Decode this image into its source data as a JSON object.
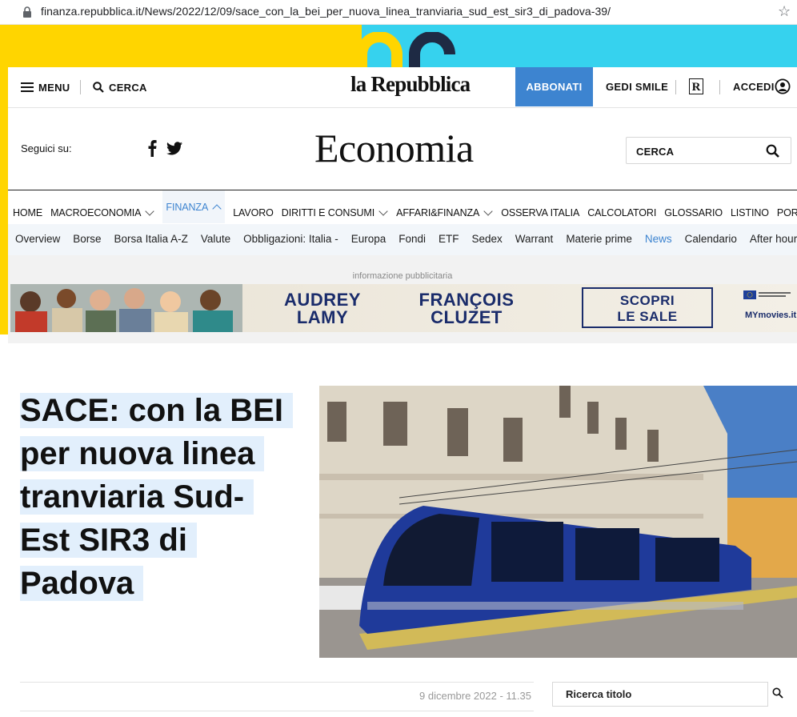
{
  "browser": {
    "url": "finanza.repubblica.it/News/2022/12/09/sace_con_la_bei_per_nuova_linea_tranviaria_sud_est_sir3_di_padova-39/"
  },
  "topbar": {
    "menu_label": "MENU",
    "search_label": "CERCA",
    "masthead": "la Repubblica",
    "subscribe_label": "ABBONATI",
    "gedi_label": "GEDI SMILE",
    "r_label": "R",
    "login_label": "ACCEDI"
  },
  "section": {
    "follow_label": "Seguici su:",
    "title": "Economia",
    "search_placeholder": "CERCA"
  },
  "nav_main": [
    {
      "label": "HOME",
      "dropdown": false
    },
    {
      "label": "MACROECONOMIA",
      "dropdown": true
    },
    {
      "label": "FINANZA",
      "dropdown": true,
      "active": true
    },
    {
      "label": "LAVORO",
      "dropdown": false
    },
    {
      "label": "DIRITTI E CONSUMI",
      "dropdown": true
    },
    {
      "label": "AFFARI&FINANZA",
      "dropdown": true
    },
    {
      "label": "OSSERVA ITALIA",
      "dropdown": false
    },
    {
      "label": "CALCOLATORI",
      "dropdown": false
    },
    {
      "label": "GLOSSARIO",
      "dropdown": false
    },
    {
      "label": "LISTINO",
      "dropdown": false
    },
    {
      "label": "PORTAFOGLIO",
      "dropdown": false
    }
  ],
  "nav_sub": [
    {
      "label": "Overview"
    },
    {
      "label": "Borse"
    },
    {
      "label": "Borsa Italia A-Z"
    },
    {
      "label": "Valute"
    },
    {
      "label": "Obbligazioni: Italia -"
    },
    {
      "label": "Europa"
    },
    {
      "label": "Fondi"
    },
    {
      "label": "ETF"
    },
    {
      "label": "Sedex"
    },
    {
      "label": "Warrant"
    },
    {
      "label": "Materie prime"
    },
    {
      "label": "News",
      "active": true
    },
    {
      "label": "Calendario"
    },
    {
      "label": "After hours"
    }
  ],
  "ad": {
    "label": "informazione pubblicitaria",
    "name1_line1": "AUDREY",
    "name1_line2": "LAMY",
    "name2_line1": "FRANÇOIS",
    "name2_line2": "CLUZET",
    "cta_line1": "SCOPRI",
    "cta_line2": "LE SALE",
    "sponsor": "MYmovies.it"
  },
  "article": {
    "headline_lines": [
      "SACE: con la BEI",
      "per nuova linea",
      "tranviaria Sud-",
      "Est SIR3 di",
      "Padova"
    ],
    "date": "9 dicembre 2022 - 11.35",
    "title_search_placeholder": "Ricerca titolo"
  },
  "colors": {
    "accent": "#3d84d0",
    "brand_yellow": "#ffd500",
    "brand_cyan": "#36d2ee",
    "headline_highlight": "#e2effc"
  }
}
